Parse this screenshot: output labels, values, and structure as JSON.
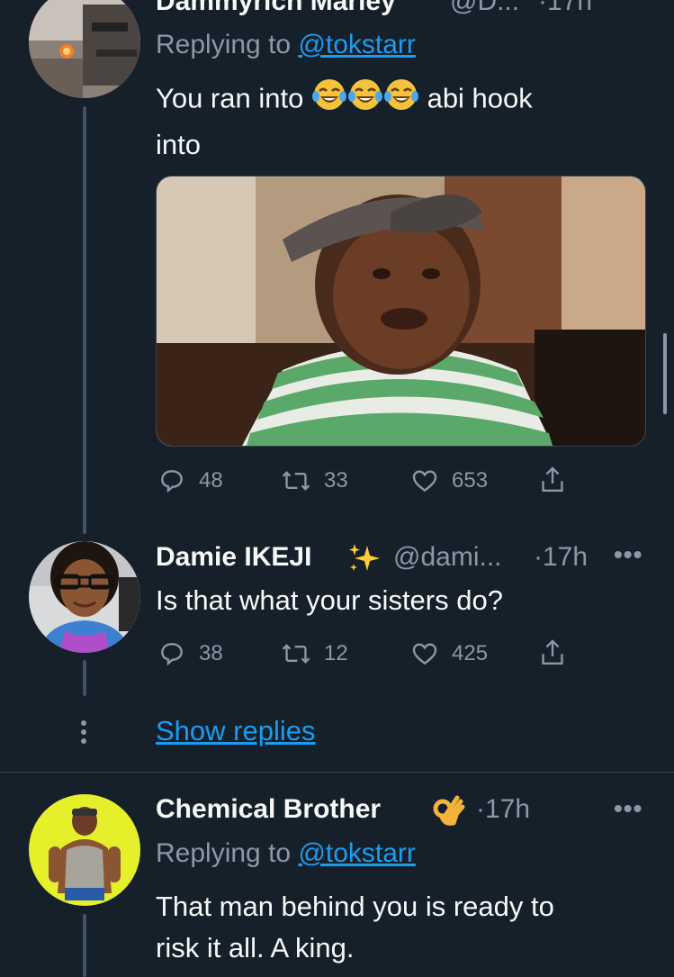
{
  "tweet1": {
    "name": "Dammyrich Marley",
    "handle": "@D...",
    "time": "·17h",
    "replying_prefix": "Replying to",
    "replying_handle": "@tokstarr",
    "text_before": "You ran into",
    "text_after": "abi hook",
    "text_line2": "into",
    "emojis": [
      "face-with-tears-of-joy",
      "face-with-tears-of-joy",
      "face-with-tears-of-joy"
    ],
    "stats": {
      "replies": "48",
      "retweets": "33",
      "likes": "653"
    }
  },
  "tweet2": {
    "name": "Damie IKEJI",
    "badge_emoji": "sparkles",
    "handle": "@dami...",
    "time": "·17h",
    "text": "Is that what your sisters do?",
    "stats": {
      "replies": "38",
      "retweets": "12",
      "likes": "425"
    }
  },
  "show_replies": "Show replies",
  "tweet3": {
    "name": "Chemical Brother",
    "badge_emoji": "ok-hand",
    "time": "·17h",
    "replying_prefix": "Replying to",
    "replying_handle": "@tokstarr",
    "text_line1": "That man behind you is ready to",
    "text_line2": "risk it all. A king."
  },
  "colors": {
    "background": "#15202b",
    "text": "#f7f9f9",
    "muted": "#8b98a5",
    "link": "#1d9bf0",
    "thread_line": "#3d5466",
    "divider": "#38444d"
  }
}
